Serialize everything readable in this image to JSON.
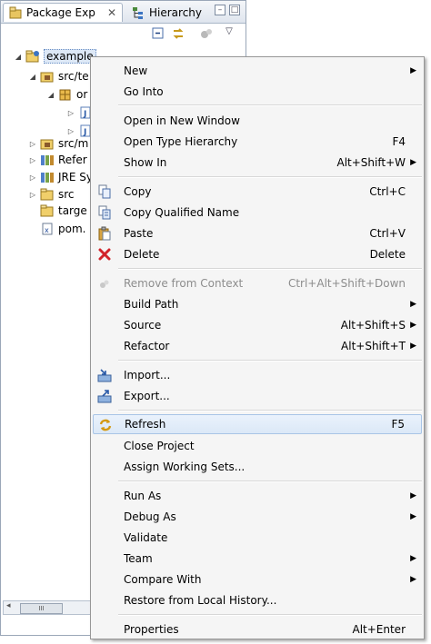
{
  "tabs": {
    "package_explorer": "Package Exp",
    "close": "✕",
    "hierarchy": "Hierarchy"
  },
  "tree": [
    {
      "label": "example",
      "twisty": "◢",
      "icon": "project",
      "selected": true
    },
    {
      "label": "src/te",
      "twisty": "◢",
      "icon": "source-folder"
    },
    {
      "label": "or",
      "twisty": "◢",
      "icon": "package"
    },
    {
      "label": "",
      "twisty": "▷",
      "icon": "java-file"
    },
    {
      "label": "",
      "twisty": "▷",
      "icon": "java-file"
    },
    {
      "label": "src/m",
      "twisty": "▷",
      "icon": "source-folder"
    },
    {
      "label": "Refer",
      "twisty": "▷",
      "icon": "library"
    },
    {
      "label": "JRE Sy",
      "twisty": "▷",
      "icon": "library"
    },
    {
      "label": "src",
      "twisty": "▷",
      "icon": "folder"
    },
    {
      "label": "targe",
      "twisty": "",
      "icon": "folder"
    },
    {
      "label": "pom.",
      "twisty": "",
      "icon": "xml-file"
    }
  ],
  "scrollbar": {
    "thumb_grip": "III"
  },
  "menu": {
    "new": {
      "label": "New",
      "shortcut": ""
    },
    "go_into": {
      "label": "Go Into"
    },
    "open_new_window": {
      "label": "Open in New Window"
    },
    "open_type_hierarchy": {
      "label": "Open Type Hierarchy",
      "shortcut": "F4"
    },
    "show_in": {
      "label": "Show In",
      "shortcut": "Alt+Shift+W"
    },
    "copy": {
      "label": "Copy",
      "shortcut": "Ctrl+C"
    },
    "copy_qualified": {
      "label": "Copy Qualified Name"
    },
    "paste": {
      "label": "Paste",
      "shortcut": "Ctrl+V"
    },
    "delete": {
      "label": "Delete",
      "shortcut": "Delete"
    },
    "remove_context": {
      "label": "Remove from Context",
      "shortcut": "Ctrl+Alt+Shift+Down"
    },
    "build_path": {
      "label": "Build Path"
    },
    "source": {
      "label": "Source",
      "shortcut": "Alt+Shift+S"
    },
    "refactor": {
      "label": "Refactor",
      "shortcut": "Alt+Shift+T"
    },
    "import": {
      "label": "Import..."
    },
    "export": {
      "label": "Export..."
    },
    "refresh": {
      "label": "Refresh",
      "shortcut": "F5"
    },
    "close_project": {
      "label": "Close Project"
    },
    "assign_working_sets": {
      "label": "Assign Working Sets..."
    },
    "run_as": {
      "label": "Run As"
    },
    "debug_as": {
      "label": "Debug As"
    },
    "validate": {
      "label": "Validate"
    },
    "team": {
      "label": "Team"
    },
    "compare_with": {
      "label": "Compare With"
    },
    "restore_history": {
      "label": "Restore from Local History..."
    },
    "properties": {
      "label": "Properties",
      "shortcut": "Alt+Enter"
    },
    "submenu_arrow": "▶"
  },
  "colors": {
    "accent": "#dbe8f7",
    "highlight_border": "#a8c4e6",
    "menu_bg": "#f5f5f5"
  }
}
